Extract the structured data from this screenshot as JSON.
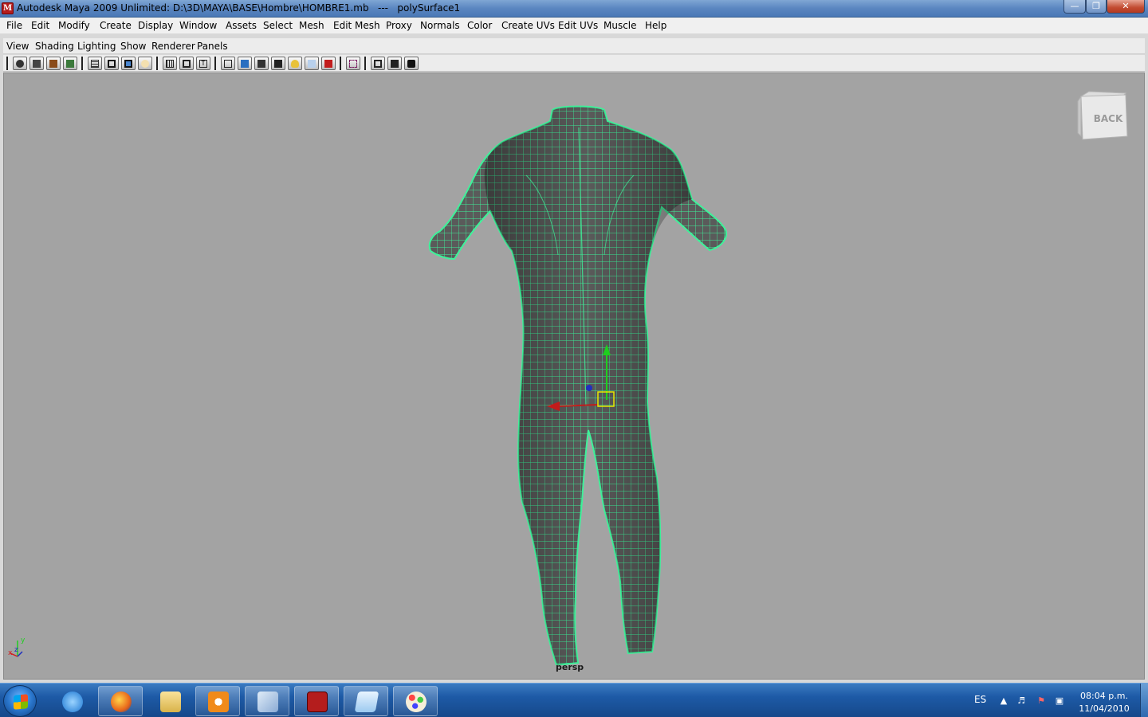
{
  "window": {
    "title": "Autodesk Maya 2009 Unlimited: D:\\3D\\MAYA\\BASE\\Hombre\\HOMBRE1.mb   ---   polySurface1",
    "icon": "maya-icon",
    "controls": {
      "minimize": "minimize-icon",
      "maximize": "maximize-icon",
      "close": "close-icon"
    }
  },
  "menubar": {
    "items": [
      "File",
      "Edit",
      "Modify",
      "Create",
      "Display",
      "Window",
      "Assets",
      "Select",
      "Mesh",
      "Edit Mesh",
      "Proxy",
      "Normals",
      "Color",
      "Create UVs",
      "Edit UVs",
      "Muscle",
      "Help"
    ]
  },
  "panel": {
    "menus": [
      "View",
      "Shading",
      "Lighting",
      "Show",
      "Renderer",
      "Panels"
    ],
    "toolbar_icons": [
      "select-camera-icon",
      "lock-camera-icon",
      "bookmark-icon",
      "image-plane-icon",
      "grid-icon",
      "film-gate-icon",
      "resolution-gate-icon",
      "gate-mask-icon",
      "field-chart-icon",
      "safe-action-icon",
      "safe-title-icon",
      "wireframe-icon",
      "smooth-shade-icon",
      "wireframe-on-shaded-icon",
      "textured-icon",
      "use-lights-icon",
      "xray-icon",
      "shadows-icon",
      "isolate-select-icon",
      "frame-all-icon",
      "frame-selected-icon",
      "pan-zoom-icon"
    ]
  },
  "viewport": {
    "camera": "persp",
    "viewcube_face": "BACK",
    "mesh_name": "polySurface1",
    "wire_color": "#3ef29a",
    "mesh_fill": "#5a5a5a",
    "axes": {
      "x": "x",
      "y": "y",
      "z": "z"
    }
  },
  "taskbar": {
    "start": "windows-start-orb",
    "apps": [
      "internet-explorer-icon",
      "firefox-icon",
      "explorer-folder-icon",
      "media-player-icon",
      "tool-icon",
      "maya-task-icon",
      "notepad-icon",
      "paint-icon"
    ],
    "tray": {
      "language": "ES",
      "time": "08:04 p.m.",
      "date": "11/04/2010"
    }
  }
}
